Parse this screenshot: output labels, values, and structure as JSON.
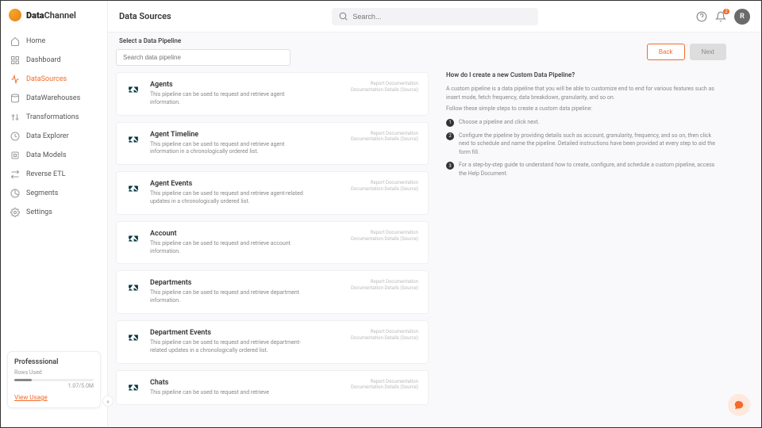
{
  "brand": {
    "name1": "Data",
    "name2": "Channel"
  },
  "header": {
    "title": "Data Sources",
    "search_placeholder": "Search...",
    "notif_count": "2",
    "avatar_initial": "R"
  },
  "sidebar": {
    "items": [
      {
        "label": "Home"
      },
      {
        "label": "Dashboard"
      },
      {
        "label": "DataSources"
      },
      {
        "label": "DataWarehouses"
      },
      {
        "label": "Transformations"
      },
      {
        "label": "Data Explorer"
      },
      {
        "label": "Data Models"
      },
      {
        "label": "Reverse ETL"
      },
      {
        "label": "Segments"
      },
      {
        "label": "Settings"
      }
    ],
    "plan": {
      "name": "Professsional",
      "rows_label": "Rows Used",
      "rows_value": "1.07/5.0M",
      "usage_link": "View Usage"
    }
  },
  "main": {
    "section_label": "Select a Data Pipeline",
    "pipeline_search_placeholder": "Search data pipeline",
    "card_meta1": "Report Documentation",
    "card_meta2": "Documentation Details (Source)",
    "pipelines": [
      {
        "title": "Agents",
        "desc": "This pipeline can be used to request and retrieve agent information."
      },
      {
        "title": "Agent Timeline",
        "desc": "This pipeline can be used to request and retrieve agent information in a chronologically ordered list."
      },
      {
        "title": "Agent Events",
        "desc": "This pipeline can be used to request and retrieve agent-related updates in a chronologically ordered list."
      },
      {
        "title": "Account",
        "desc": "This pipeline can be used to request and retrieve account information."
      },
      {
        "title": "Departments",
        "desc": "This pipeline can be used to request and retrieve department information."
      },
      {
        "title": "Department Events",
        "desc": "This pipeline can be used to request and retrieve department-related updates in a chronologically ordered list."
      },
      {
        "title": "Chats",
        "desc": "This pipeline can be used to request and retrieve"
      }
    ]
  },
  "wizard": {
    "back": "Back",
    "next": "Next"
  },
  "help": {
    "title": "How do I create a new Custom Data Pipeline?",
    "intro": "A custom pipeline is a data pipeline that you will be able to customize end to end for various features such as insert mode, fetch frequency, data breakdown, granularity, and so on.",
    "sub": "Follow these simple steps to create a custom data pipeline:",
    "steps": [
      "Choose a pipeline and click next.",
      "Configure the pipeline by providing details such as account, granularity, frequency, and so on, then click next to schedule and name the pipeline. Detailed instructions have been provided at every step to aid the form fill.",
      "For a step-by-step guide to understand how to create, configure, and schedule a custom pipeline, access the Help Document."
    ]
  }
}
